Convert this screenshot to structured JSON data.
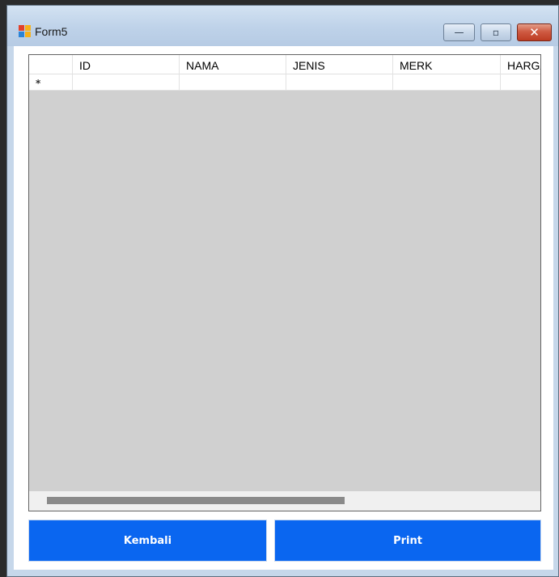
{
  "window": {
    "title": "Form5",
    "controls": {
      "minimize_glyph": "—",
      "maximize_glyph": "▫",
      "close_glyph": "✕"
    }
  },
  "grid": {
    "columns": [
      "ID",
      "NAMA",
      "JENIS",
      "MERK",
      "HARGA"
    ],
    "new_row_marker": "*"
  },
  "buttons": {
    "kembali": "Kembali",
    "print": "Print"
  },
  "colors": {
    "button_bg": "#0a66f0",
    "grid_bg": "#d0d0d0",
    "title_bar": "#bed2e9",
    "close_button": "#cf5b43"
  },
  "icons": {
    "app_icon": "windows-form-icon",
    "minimize": "minimize-icon",
    "maximize": "maximize-icon",
    "close": "close-icon"
  }
}
